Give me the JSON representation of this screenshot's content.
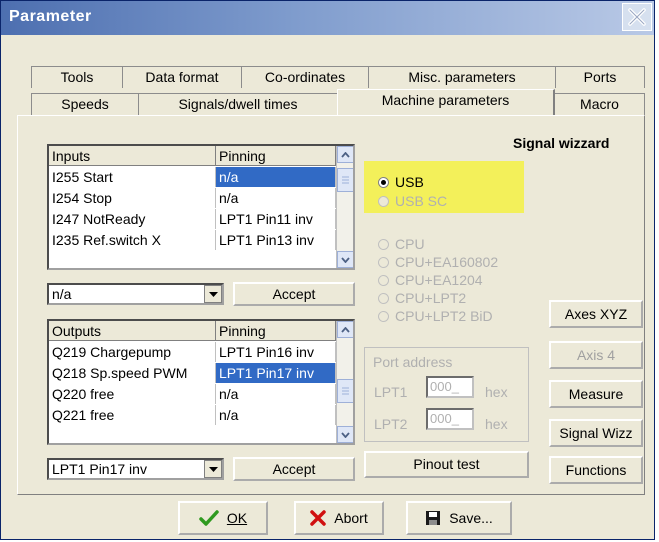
{
  "window": {
    "title": "Parameter"
  },
  "tabs_row1": [
    "Tools",
    "Data format",
    "Co-ordinates",
    "Misc. parameters",
    "Ports"
  ],
  "tabs_row2": [
    "Speeds",
    "Signals/dwell times",
    "Machine parameters",
    "Macro"
  ],
  "active_tab": "Machine parameters",
  "signal_wizzard_title": "Signal wizzard",
  "inputs_list": {
    "headers": [
      "Inputs",
      "Pinning"
    ],
    "rows": [
      [
        "I255 Start",
        "n/a"
      ],
      [
        "I254 Stop",
        "n/a"
      ],
      [
        "I247 NotReady",
        "LPT1 Pin11 inv"
      ],
      [
        "I235 Ref.switch X",
        "LPT1 Pin13 inv"
      ]
    ],
    "selected_index": 0
  },
  "inputs_combo": {
    "value": "n/a"
  },
  "inputs_accept": "Accept",
  "outputs_list": {
    "headers": [
      "Outputs",
      "Pinning"
    ],
    "rows": [
      [
        "Q219 Chargepump",
        "LPT1 Pin16 inv"
      ],
      [
        "Q218 Sp.speed PWM",
        "LPT1 Pin17 inv"
      ],
      [
        "Q220 free",
        "n/a"
      ],
      [
        "Q221 free",
        "n/a"
      ]
    ],
    "selected_index": 1
  },
  "outputs_combo": {
    "value": "LPT1 Pin17 inv"
  },
  "outputs_accept": "Accept",
  "usb_options": [
    {
      "label": "USB",
      "selected": true,
      "enabled": true
    },
    {
      "label": "USB SC",
      "selected": false,
      "enabled": false
    }
  ],
  "cpu_options": [
    {
      "label": "CPU"
    },
    {
      "label": "CPU+EA160802"
    },
    {
      "label": "CPU+EA1204"
    },
    {
      "label": "CPU+LPT2"
    },
    {
      "label": "CPU+LPT2 BiD"
    }
  ],
  "port_address": {
    "title": "Port address",
    "lpt1_label": "LPT1",
    "lpt1_value": "000_",
    "lpt1_unit": "hex",
    "lpt2_label": "LPT2",
    "lpt2_value": "000_",
    "lpt2_unit": "hex"
  },
  "pinout_test": "Pinout test",
  "side_buttons": {
    "axes_xyz": "Axes XYZ",
    "axis4": "Axis 4",
    "measure": "Measure",
    "signal_wizz": "Signal Wizz",
    "functions": "Functions"
  },
  "bottom_buttons": {
    "ok": "OK",
    "abort": "Abort",
    "save": "Save..."
  },
  "colors": {
    "highlight": "#f3f05a",
    "selection": "#316ac5",
    "ok_icon": "#2f9a1f",
    "abort_icon": "#d01010"
  }
}
